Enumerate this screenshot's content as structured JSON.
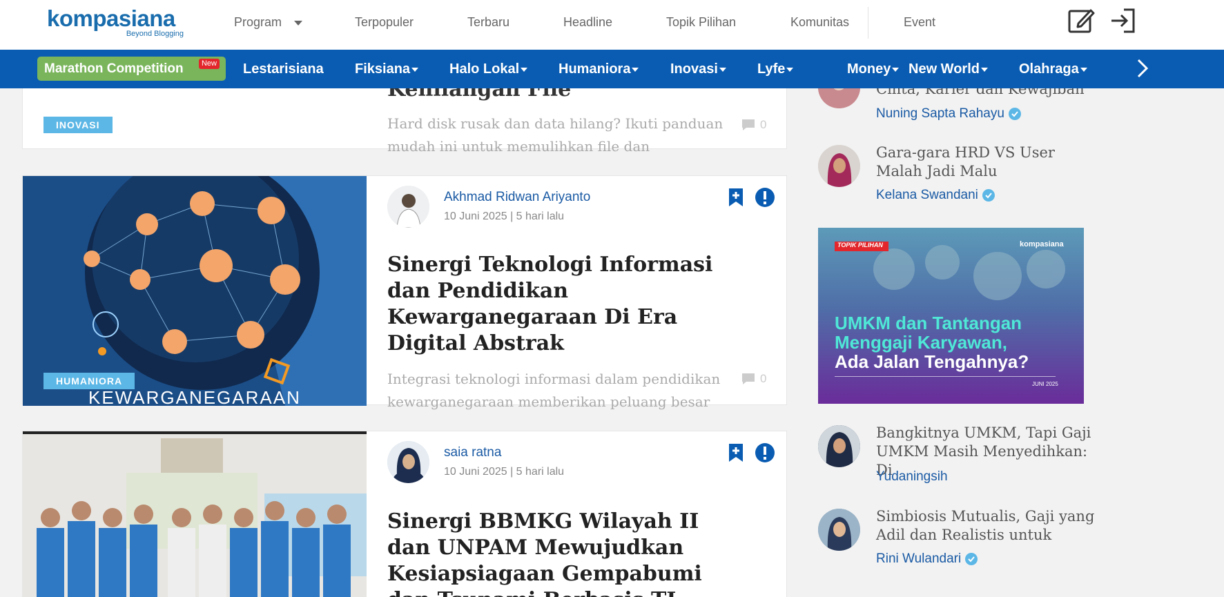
{
  "header": {
    "logo_text": "kompasiana",
    "logo_tagline": "Beyond Blogging",
    "nav": [
      "Program",
      "Terpopuler",
      "Terbaru",
      "Headline",
      "Topik Pilihan",
      "Komunitas",
      "Event"
    ],
    "write_icon": "edit-icon",
    "login_icon": "login-icon"
  },
  "categories": {
    "marathon_label": "Marathon Competition",
    "marathon_badge": "New",
    "items": [
      "Lestarisiana",
      "Fiksiana",
      "Halo Lokal",
      "Humaniora",
      "Inovasi",
      "Lyfe",
      "Money",
      "New World",
      "Olahraga"
    ]
  },
  "articles": [
    {
      "category": "INOVASI",
      "title_partial": "Kehilangan File",
      "excerpt": "Hard disk rusak dan data hilang? Ikuti panduan mudah ini untuk memulihkan file dan",
      "comments": "0"
    },
    {
      "category": "HUMANIORA",
      "author": "Akhmad Ridwan Ariyanto",
      "date": "10 Juni 2025 | 5 hari lalu",
      "title": "Sinergi Teknologi Informasi dan Pendidikan Kewarganegaraan Di Era Digital Abstrak",
      "excerpt": "Integrasi teknologi informasi dalam pendidikan kewarganegaraan memberikan peluang besar",
      "comments": "0",
      "image_caption": "KEWARGANEGARAAN"
    },
    {
      "author": "saia ratna",
      "date": "10 Juni 2025 | 5 hari lalu",
      "title": "Sinergi BBMKG Wilayah II dan UNPAM Mewujudkan Kesiapsiagaan Gempabumi dan Tsunami Berbasis TI"
    }
  ],
  "sidebar": {
    "items": [
      {
        "title": "Cinta, Karier dan Kewajiban",
        "author": "Nuning Sapta Rahayu",
        "verified": true
      },
      {
        "title": "Gara-gara HRD VS User Malah Jadi Malu",
        "author": "Kelana Swandani",
        "verified": true
      },
      {
        "title": "Bangkitnya UMKM, Tapi Gaji UMKM Masih Menyedihkan: Di",
        "author": "Yudaningsih",
        "verified": false
      },
      {
        "title": "Simbiosis Mutualis, Gaji yang Adil dan Realistis untuk",
        "author": "Rini Wulandari",
        "verified": true
      }
    ],
    "promo": {
      "tag": "TOPIK PILIHAN",
      "brand": "kompasiana",
      "headline_line1": "UMKM dan Tantangan",
      "headline_line2": "Menggaji Karyawan,",
      "headline_line3": "Ada Jalan Tengahnya?",
      "date": "JUNI 2025"
    }
  },
  "colors": {
    "brand_blue": "#0a5cb2",
    "marathon_green": "#7ab55c",
    "category_badge": "#5cb7e6",
    "link_blue": "#1a5aa4"
  }
}
